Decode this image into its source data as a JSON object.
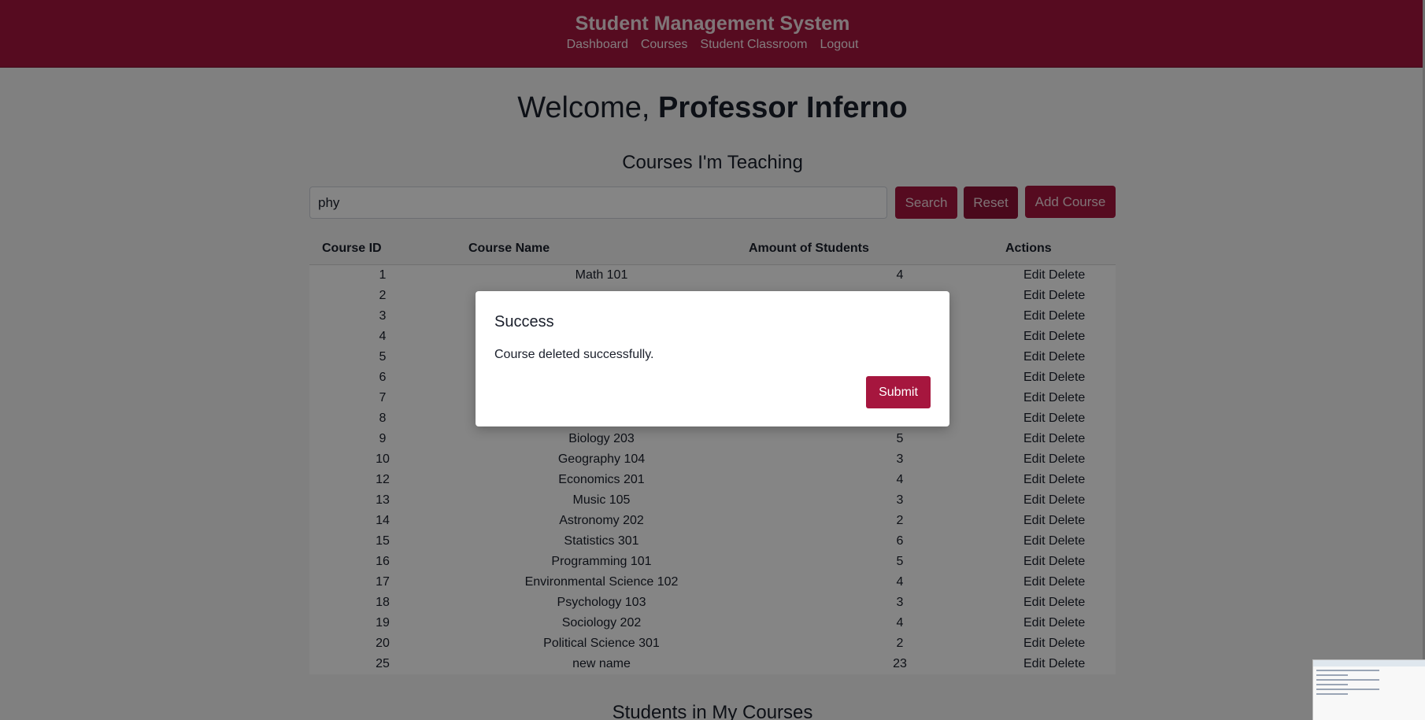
{
  "header": {
    "title": "Student Management System",
    "nav": [
      "Dashboard",
      "Courses",
      "Student Classroom",
      "Logout"
    ]
  },
  "welcome": {
    "prefix": "Welcome,",
    "name": "Professor Inferno"
  },
  "courses_section": {
    "title": "Courses I'm Teaching",
    "search": {
      "value": "phy",
      "placeholder": ""
    },
    "buttons": {
      "search": "Search",
      "reset": "Reset",
      "add": "Add Course"
    },
    "columns": [
      "Course ID",
      "Course Name",
      "Amount of Students",
      "Actions"
    ],
    "rows": [
      {
        "id": "1",
        "name": "Math 101",
        "amount": "4"
      },
      {
        "id": "2",
        "name": "",
        "amount": ""
      },
      {
        "id": "3",
        "name": "",
        "amount": ""
      },
      {
        "id": "4",
        "name": "",
        "amount": ""
      },
      {
        "id": "5",
        "name": "",
        "amount": ""
      },
      {
        "id": "6",
        "name": "",
        "amount": ""
      },
      {
        "id": "7",
        "name": "",
        "amount": ""
      },
      {
        "id": "8",
        "name": "",
        "amount": ""
      },
      {
        "id": "9",
        "name": "Biology 203",
        "amount": "5"
      },
      {
        "id": "10",
        "name": "Geography 104",
        "amount": "3"
      },
      {
        "id": "12",
        "name": "Economics 201",
        "amount": "4"
      },
      {
        "id": "13",
        "name": "Music 105",
        "amount": "3"
      },
      {
        "id": "14",
        "name": "Astronomy 202",
        "amount": "2"
      },
      {
        "id": "15",
        "name": "Statistics 301",
        "amount": "6"
      },
      {
        "id": "16",
        "name": "Programming 101",
        "amount": "5"
      },
      {
        "id": "17",
        "name": "Environmental Science 102",
        "amount": "4"
      },
      {
        "id": "18",
        "name": "Psychology 103",
        "amount": "3"
      },
      {
        "id": "19",
        "name": "Sociology 202",
        "amount": "4"
      },
      {
        "id": "20",
        "name": "Political Science 301",
        "amount": "2"
      },
      {
        "id": "25",
        "name": "new name",
        "amount": "23"
      }
    ],
    "actions": {
      "edit": "Edit",
      "delete": "Delete"
    }
  },
  "students_section": {
    "title": "Students in My Courses"
  },
  "modal": {
    "title": "Success",
    "message": "Course deleted successfully.",
    "submit": "Submit"
  },
  "colors": {
    "brand": "#a6163e",
    "overlay": "rgba(0,0,0,0.48)"
  }
}
